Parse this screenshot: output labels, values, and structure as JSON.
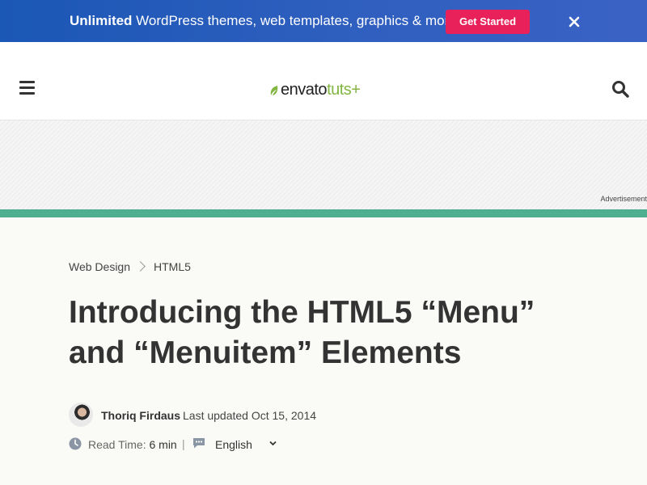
{
  "promo": {
    "bold": "Unlimited",
    "text": " WordPress themes, web templates, graphics & more!",
    "cta_label": "Get Started",
    "close_icon": "close-icon"
  },
  "header": {
    "menu_icon": "hamburger-icon",
    "logo": {
      "envato": "envato",
      "tuts": "tuts+"
    },
    "search_icon": "search-icon"
  },
  "ad": {
    "label": "Advertisement"
  },
  "breadcrumb": {
    "items": [
      "Web Design",
      "HTML5"
    ]
  },
  "article": {
    "title": "Introducing the HTML5 “Menu” and “Menuitem” Elements",
    "author": "Thoriq Firdaus",
    "updated": "Last updated Oct 15, 2014",
    "read_time_label": "Read Time:",
    "read_time_value": "6 min",
    "language": "English"
  },
  "colors": {
    "promo_bg": "#2f5fbf",
    "cta": "#e8215a",
    "accent_bar": "#4fae8f",
    "tuts_green": "#82b541"
  }
}
